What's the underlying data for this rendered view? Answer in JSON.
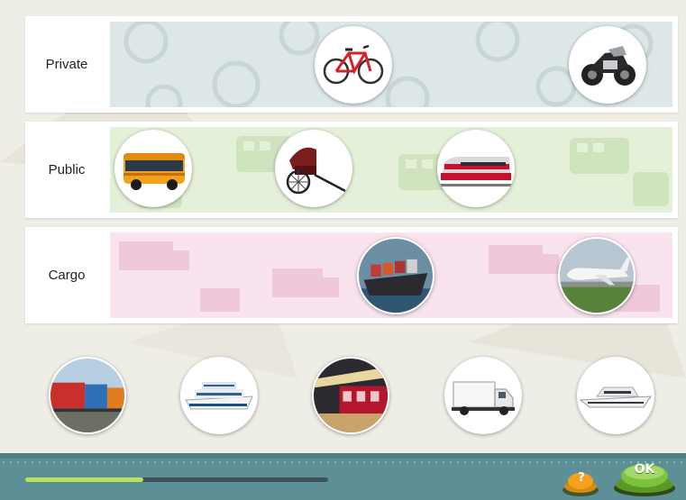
{
  "categories": [
    {
      "key": "private",
      "label": "Private",
      "zone_color": "#dde7e8",
      "items": [
        "bicycle-icon",
        "motorcycle-icon"
      ]
    },
    {
      "key": "public",
      "label": "Public",
      "zone_color": "#e4f1d8",
      "items": [
        "bus-icon",
        "rickshaw-icon",
        "train-icon"
      ]
    },
    {
      "key": "cargo",
      "label": "Cargo",
      "zone_color": "#f8e3ef",
      "items": [
        "cargo-ship-icon",
        "cargo-plane-icon"
      ]
    }
  ],
  "tray": [
    "freight-train-icon",
    "cruise-ship-icon",
    "subway-icon",
    "truck-icon",
    "yacht-icon"
  ],
  "progress": 0.39,
  "help_label": "?",
  "ok_label": "OK",
  "colors": {
    "background": "#efeee6",
    "footer": "#5e8f96",
    "progress_fill": "#b8e25a",
    "ok_button": "#7cc23a",
    "help_button": "#f0a020"
  }
}
